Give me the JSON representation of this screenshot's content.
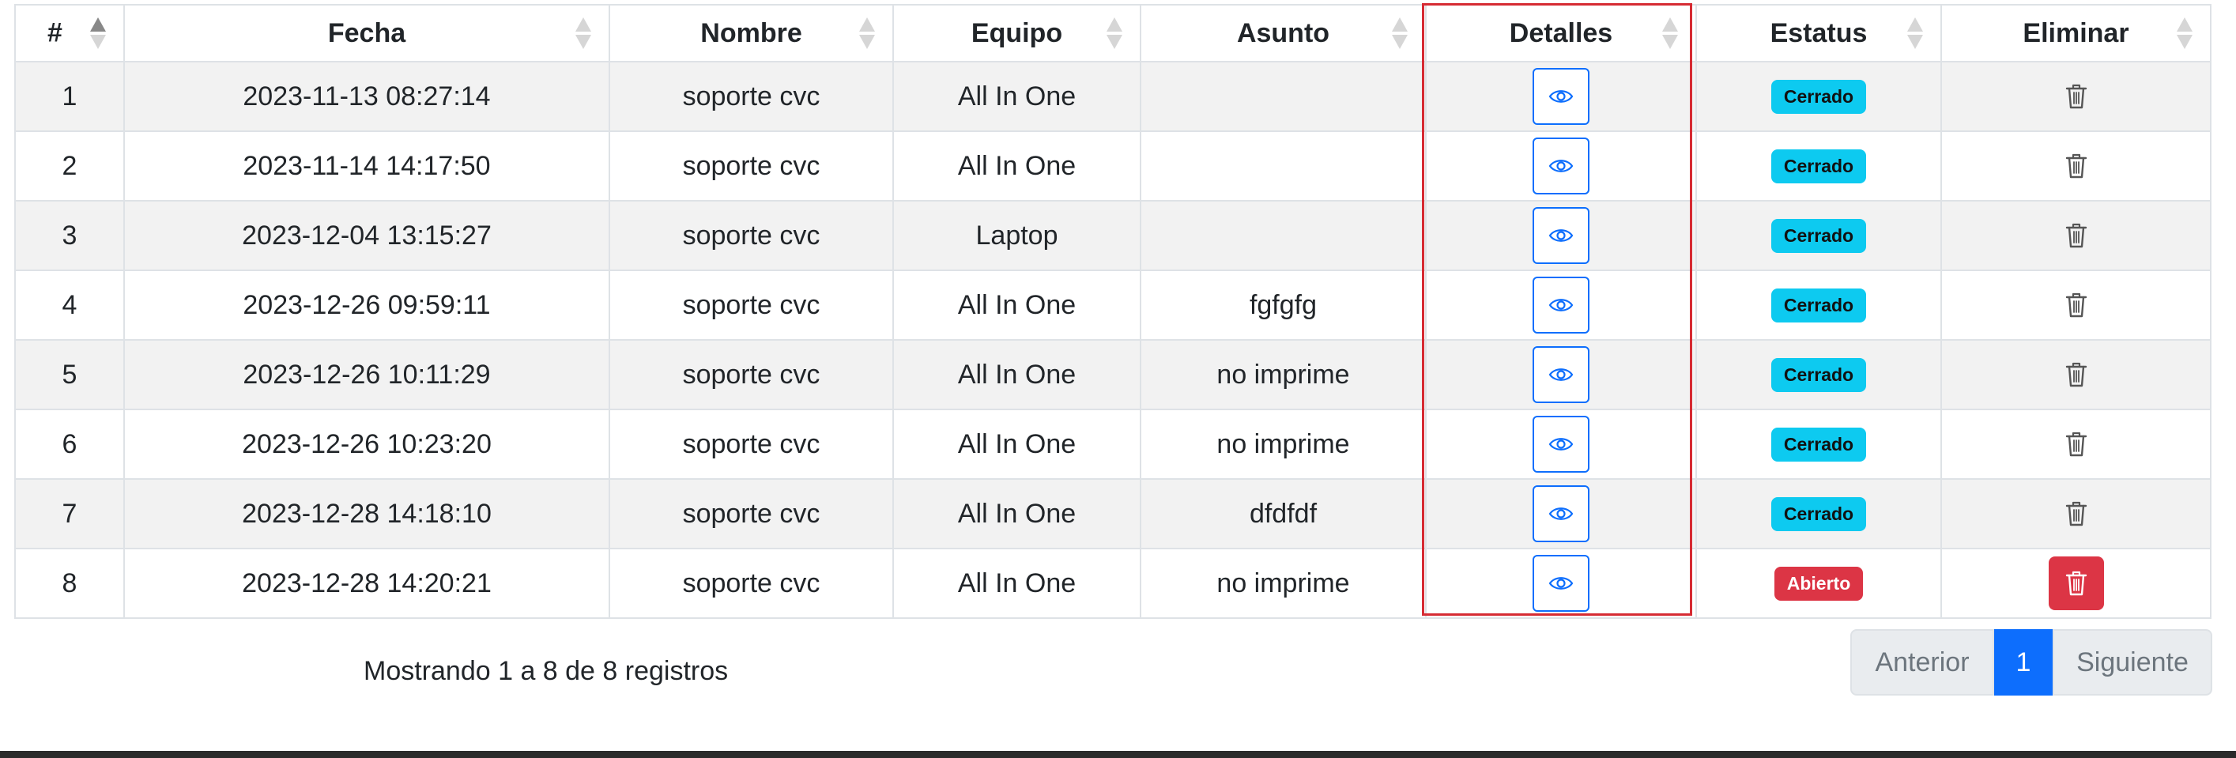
{
  "table": {
    "headers": {
      "num": "#",
      "fecha": "Fecha",
      "nombre": "Nombre",
      "equipo": "Equipo",
      "asunto": "Asunto",
      "detalles": "Detalles",
      "estatus": "Estatus",
      "eliminar": "Eliminar"
    },
    "sorted_column": "#",
    "rows": [
      {
        "num": "1",
        "fecha": "2023-11-13 08:27:14",
        "nombre": "soporte cvc",
        "equipo": "All In One",
        "asunto": "",
        "estatus": "Cerrado"
      },
      {
        "num": "2",
        "fecha": "2023-11-14 14:17:50",
        "nombre": "soporte cvc",
        "equipo": "All In One",
        "asunto": "",
        "estatus": "Cerrado"
      },
      {
        "num": "3",
        "fecha": "2023-12-04 13:15:27",
        "nombre": "soporte cvc",
        "equipo": "Laptop",
        "asunto": "",
        "estatus": "Cerrado"
      },
      {
        "num": "4",
        "fecha": "2023-12-26 09:59:11",
        "nombre": "soporte cvc",
        "equipo": "All In One",
        "asunto": "fgfgfg",
        "estatus": "Cerrado"
      },
      {
        "num": "5",
        "fecha": "2023-12-26 10:11:29",
        "nombre": "soporte cvc",
        "equipo": "All In One",
        "asunto": "no imprime",
        "estatus": "Cerrado"
      },
      {
        "num": "6",
        "fecha": "2023-12-26 10:23:20",
        "nombre": "soporte cvc",
        "equipo": "All In One",
        "asunto": "no imprime",
        "estatus": "Cerrado"
      },
      {
        "num": "7",
        "fecha": "2023-12-28 14:18:10",
        "nombre": "soporte cvc",
        "equipo": "All In One",
        "asunto": "dfdfdf",
        "estatus": "Cerrado"
      },
      {
        "num": "8",
        "fecha": "2023-12-28 14:20:21",
        "nombre": "soporte cvc",
        "equipo": "All In One",
        "asunto": "no imprime",
        "estatus": "Abierto"
      }
    ]
  },
  "icons": {
    "view": "eye-icon",
    "delete": "trash-icon",
    "sort": "sort-arrows-icon"
  },
  "colors": {
    "status_closed": "#0dcaf0",
    "status_open": "#dc3545",
    "primary": "#0d6efd",
    "highlight_border": "#d62b33"
  },
  "footer": {
    "info": "Mostrando 1 a 8 de 8 registros",
    "pagination": {
      "previous": "Anterior",
      "current_page": "1",
      "next": "Siguiente"
    }
  }
}
